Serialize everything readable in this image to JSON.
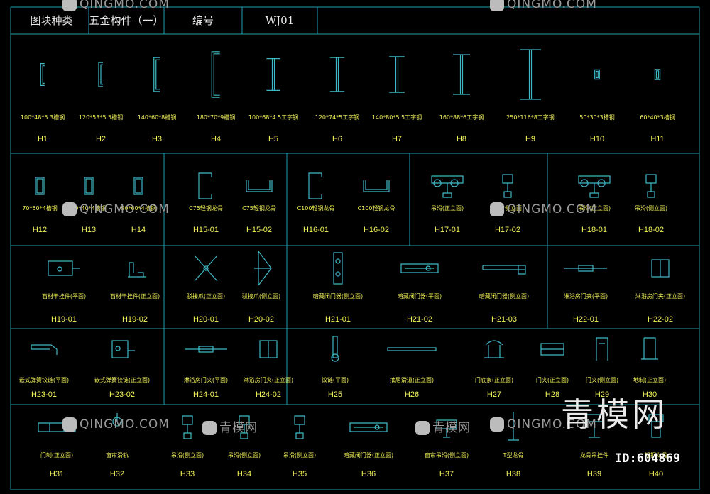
{
  "colors": {
    "frame": "#1f9bb0",
    "symbol": "#3fb8c6",
    "label": "#f2f25a",
    "header": "#e8e8e8",
    "background": "#000000"
  },
  "header": {
    "category_label": "图块种类",
    "category_value": "五金构件（一）",
    "code_label": "编号",
    "code_value": "WJ01"
  },
  "rows": [
    {
      "items": [
        {
          "label": "100*48*5.3槽钢",
          "code": "H1",
          "icon": "channel-steel-icon"
        },
        {
          "label": "120*53*5.5槽钢",
          "code": "H2",
          "icon": "channel-steel-icon"
        },
        {
          "label": "140*60*8槽钢",
          "code": "H3",
          "icon": "channel-steel-icon"
        },
        {
          "label": "180*70*9槽钢",
          "code": "H4",
          "icon": "channel-steel-icon"
        },
        {
          "label": "100*68*4.5工字钢",
          "code": "H5",
          "icon": "i-beam-icon"
        },
        {
          "label": "120*74*5工字钢",
          "code": "H6",
          "icon": "i-beam-icon"
        },
        {
          "label": "140*80*5.5工字钢",
          "code": "H7",
          "icon": "i-beam-icon"
        },
        {
          "label": "160*88*6工字钢",
          "code": "H8",
          "icon": "i-beam-icon"
        },
        {
          "label": "250*116*8工字钢",
          "code": "H9",
          "icon": "i-beam-icon"
        },
        {
          "label": "50*30*3槽钢",
          "code": "H10",
          "icon": "rect-tube-icon"
        },
        {
          "label": "60*40*3槽钢",
          "code": "H11",
          "icon": "rect-tube-icon"
        }
      ]
    },
    {
      "items": [
        {
          "label": "70*50*4槽钢",
          "code": "H12",
          "icon": "rect-tube-icon"
        },
        {
          "label": "80*40*4槽钢",
          "code": "H13",
          "icon": "rect-tube-icon"
        },
        {
          "label": "90*60*4槽钢",
          "code": "H14",
          "icon": "rect-tube-icon"
        },
        {
          "label": "C75轻钢龙骨",
          "code": "H15-01",
          "icon": "c-stud-icon"
        },
        {
          "label": "C75轻钢龙骨",
          "code": "H15-02",
          "icon": "u-track-icon"
        },
        {
          "label": "C100轻钢龙骨",
          "code": "H16-01",
          "icon": "c-stud-icon"
        },
        {
          "label": "C100轻钢龙骨",
          "code": "H16-02",
          "icon": "u-track-icon"
        },
        {
          "label": "吊滑(正立面)",
          "code": "H17-01",
          "icon": "hanging-roller-icon"
        },
        {
          "label": "吊滑(侧立面)",
          "code": "H17-02",
          "icon": "hanging-roller-side-icon"
        },
        {
          "label": "吊滑(正立面)",
          "code": "H18-01",
          "icon": "hanging-roller-icon"
        },
        {
          "label": "吊滑(侧立面)",
          "code": "H18-02",
          "icon": "hanging-roller-side-icon"
        }
      ]
    },
    {
      "items": [
        {
          "label": "石材干挂件(平面)",
          "code": "H19-01",
          "icon": "stone-bracket-plan-icon"
        },
        {
          "label": "石材干挂件(正立面)",
          "code": "H19-02",
          "icon": "stone-bracket-elev-icon"
        },
        {
          "label": "驳接爪(正立面)",
          "code": "H20-01",
          "icon": "spider-fitting-icon"
        },
        {
          "label": "驳接爪(侧立面)",
          "code": "H20-02",
          "icon": "spider-fitting-side-icon"
        },
        {
          "label": "暗藏闭门器(侧立面)",
          "code": "H21-01",
          "icon": "door-closer-side-icon"
        },
        {
          "label": "暗藏闭门器(平面)",
          "code": "H21-02",
          "icon": "door-closer-plan-icon"
        },
        {
          "label": "暗藏闭门器(侧立面)",
          "code": "H21-03",
          "icon": "door-closer-arm-icon"
        },
        {
          "label": "淋浴房门夹(平面)",
          "code": "H22-01",
          "icon": "shower-clamp-plan-icon"
        },
        {
          "label": "淋浴房门夹(正立面)",
          "code": "H22-02",
          "icon": "shower-clamp-elev-icon"
        }
      ]
    },
    {
      "items": [
        {
          "label": "嵌式弹簧铰链(平面)",
          "code": "H23-01",
          "icon": "spring-hinge-plan-icon"
        },
        {
          "label": "嵌式弹簧铰链(正立面)",
          "code": "H23-02",
          "icon": "spring-hinge-elev-icon"
        },
        {
          "label": "淋浴房门夹(平面)",
          "code": "H24-01",
          "icon": "shower-clamp-plan-icon"
        },
        {
          "label": "淋浴房门夹(正立面)",
          "code": "H24-02",
          "icon": "shower-clamp-elev-icon"
        },
        {
          "label": "铰链(平面)",
          "code": "H25",
          "icon": "hinge-plan-icon"
        },
        {
          "label": "抽屉滑道(正立面)",
          "code": "H26",
          "icon": "drawer-slide-icon"
        },
        {
          "label": "门底条(正立面)",
          "code": "H27",
          "icon": "door-sweep-icon"
        },
        {
          "label": "门夹(正立面)",
          "code": "H28",
          "icon": "door-clamp-icon"
        },
        {
          "label": "门夹(侧立面)",
          "code": "H29",
          "icon": "door-clamp-side-icon"
        },
        {
          "label": "地制(正立面)",
          "code": "H30",
          "icon": "floor-stop-icon"
        }
      ]
    },
    {
      "items": [
        {
          "label": "门制(正立面)",
          "code": "H31",
          "icon": "door-stop-icon"
        },
        {
          "label": "窗帘滑轨",
          "code": "H32",
          "icon": "curtain-track-icon"
        },
        {
          "label": "吊滑(侧立面)",
          "code": "H33",
          "icon": "hanging-roller-side-icon"
        },
        {
          "label": "吊滑(侧立面)",
          "code": "H34",
          "icon": "hanging-roller-side-icon"
        },
        {
          "label": "吊滑(侧立面)",
          "code": "H35",
          "icon": "hanging-roller-side-icon"
        },
        {
          "label": "暗藏闭门器(正立面)",
          "code": "H36",
          "icon": "door-closer-plan-icon"
        },
        {
          "label": "窗帘吊滑(侧立面)",
          "code": "H37",
          "icon": "curtain-roller-icon"
        },
        {
          "label": "T型龙骨",
          "code": "H38",
          "icon": "t-runner-icon"
        },
        {
          "label": "龙骨吊挂件",
          "code": "H39",
          "icon": "runner-hanger-icon"
        },
        {
          "label": "轻钢龙骨",
          "code": "H40",
          "icon": "light-steel-runner-icon"
        }
      ]
    }
  ],
  "watermarks": [
    "QINGMO.COM",
    "青模网"
  ],
  "brand": {
    "text": "青模网",
    "id": "ID:604869"
  }
}
